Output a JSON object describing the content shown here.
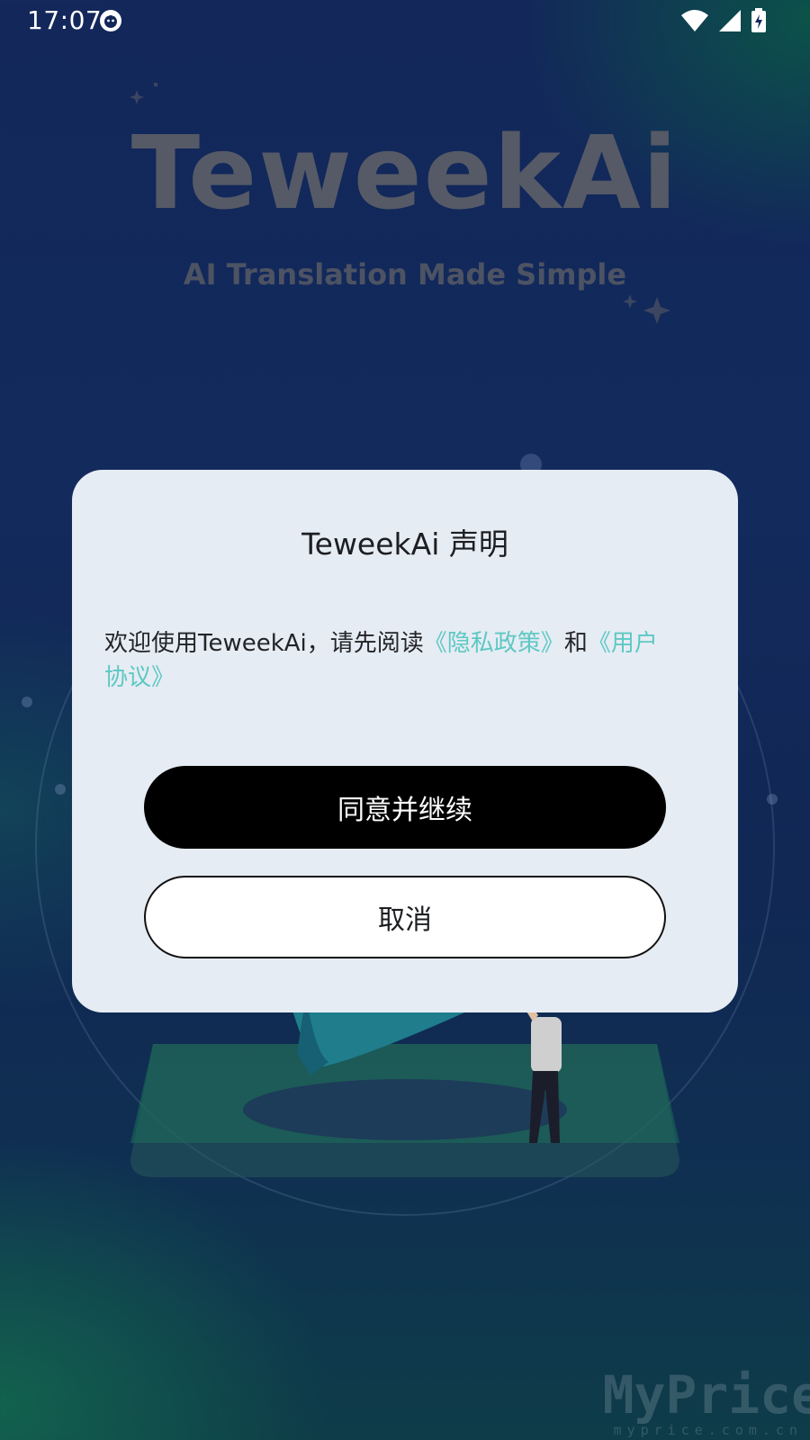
{
  "status_bar": {
    "time": "17:07",
    "icons": [
      "app-notification-icon",
      "wifi-icon",
      "signal-icon",
      "battery-charging-icon"
    ]
  },
  "background": {
    "brand_title": "TeweekAi",
    "brand_subtitle": "AI Translation Made Simple"
  },
  "dialog": {
    "title": "TeweekAi 声明",
    "message_prefix": "欢迎使用TeweekAi，请先阅读",
    "privacy_link": "《隐私政策》",
    "message_and": "和",
    "agreement_link": "《用户协议》",
    "agree_button": "同意并继续",
    "cancel_button": "取消"
  },
  "watermark": {
    "main": "MyPrice",
    "sub": "myprice.com.cn"
  },
  "colors": {
    "link": "#5ec8c4",
    "dialog_bg": "#e6ecf3",
    "primary_button": "#000000"
  }
}
